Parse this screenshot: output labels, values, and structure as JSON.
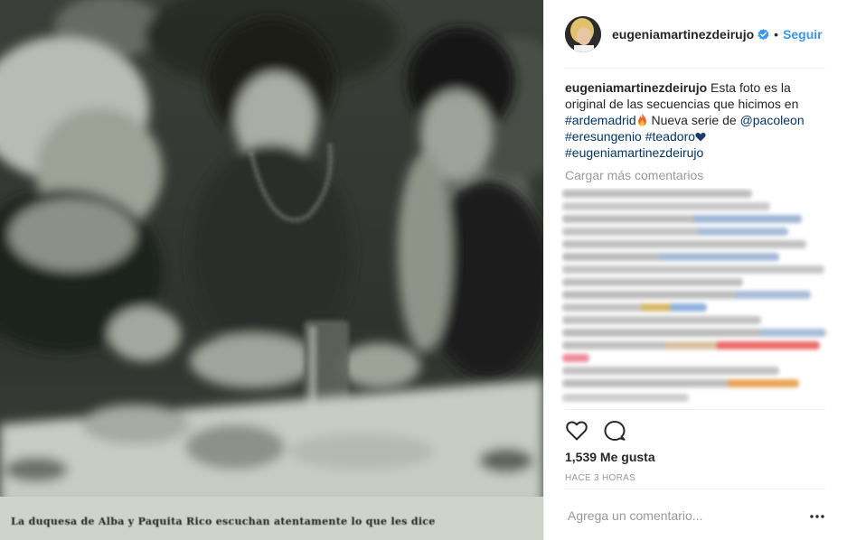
{
  "photo": {
    "alt_caption": "La duquesa de Alba y Paquita Rico escuchan atentamente lo que les dice"
  },
  "header": {
    "username": "eugeniamartinezdeirujo",
    "separator": "•",
    "follow_label": "Seguir"
  },
  "caption": {
    "username": "eugeniamartinezdeirujo",
    "text_1": "Esta foto es la original de las secuencias que hicimos en",
    "hashtag_1": "#ardemadrid",
    "text_2": "Nueva serie de",
    "mention_1": "@pacoleon",
    "hashtag_2": "#eresungenio",
    "hashtag_3": "#teadoro",
    "hashtag_4": "#eugeniamartinezdeirujo"
  },
  "load_more_label": "Cargar más comentarios",
  "actions": {
    "like_icon": "heart-icon",
    "comment_icon": "comment-icon",
    "more_icon": "more-options-icon"
  },
  "likes_label": "1,539 Me gusta",
  "time_label": "HACE 3 HORAS",
  "comment_input": {
    "placeholder": "Agrega un comentario..."
  },
  "colors": {
    "link": "#003569",
    "follow": "#3897f0",
    "muted": "#999999",
    "text": "#262626",
    "verified": "#3897f0"
  }
}
